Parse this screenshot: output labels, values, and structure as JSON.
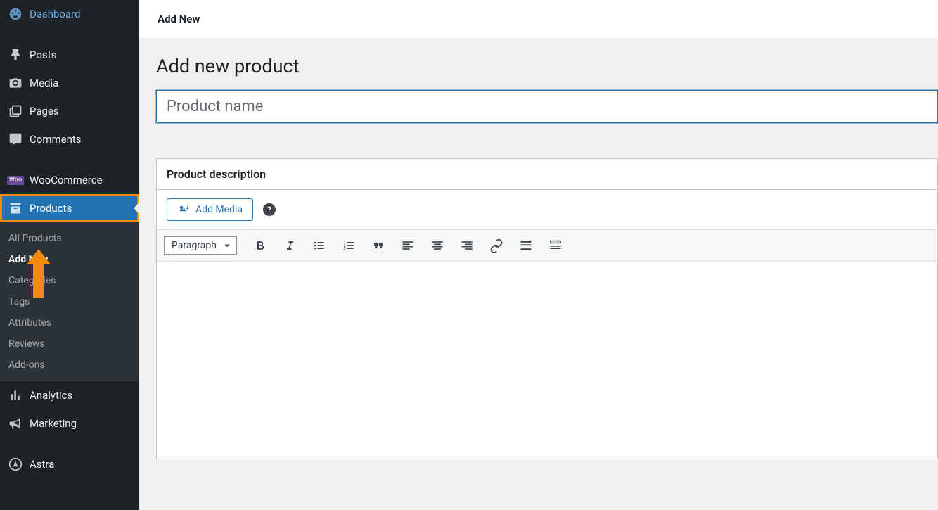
{
  "sidebar": {
    "items": [
      {
        "label": "Dashboard",
        "icon": "gauge"
      },
      {
        "label": "Posts",
        "icon": "pin"
      },
      {
        "label": "Media",
        "icon": "camera"
      },
      {
        "label": "Pages",
        "icon": "pages"
      },
      {
        "label": "Comments",
        "icon": "comment"
      },
      {
        "label": "WooCommerce",
        "icon": "woo"
      },
      {
        "label": "Products",
        "icon": "archive"
      },
      {
        "label": "Analytics",
        "icon": "chart"
      },
      {
        "label": "Marketing",
        "icon": "megaphone"
      },
      {
        "label": "Astra",
        "icon": "astra"
      }
    ],
    "submenu": [
      {
        "label": "All Products"
      },
      {
        "label": "Add New"
      },
      {
        "label": "Categories"
      },
      {
        "label": "Tags"
      },
      {
        "label": "Attributes"
      },
      {
        "label": "Reviews"
      },
      {
        "label": "Add-ons"
      }
    ]
  },
  "topbar": {
    "title": "Add New"
  },
  "page": {
    "title": "Add new product",
    "name_placeholder": "Product name",
    "description_label": "Product description",
    "add_media_label": "Add Media",
    "format_label": "Paragraph"
  }
}
